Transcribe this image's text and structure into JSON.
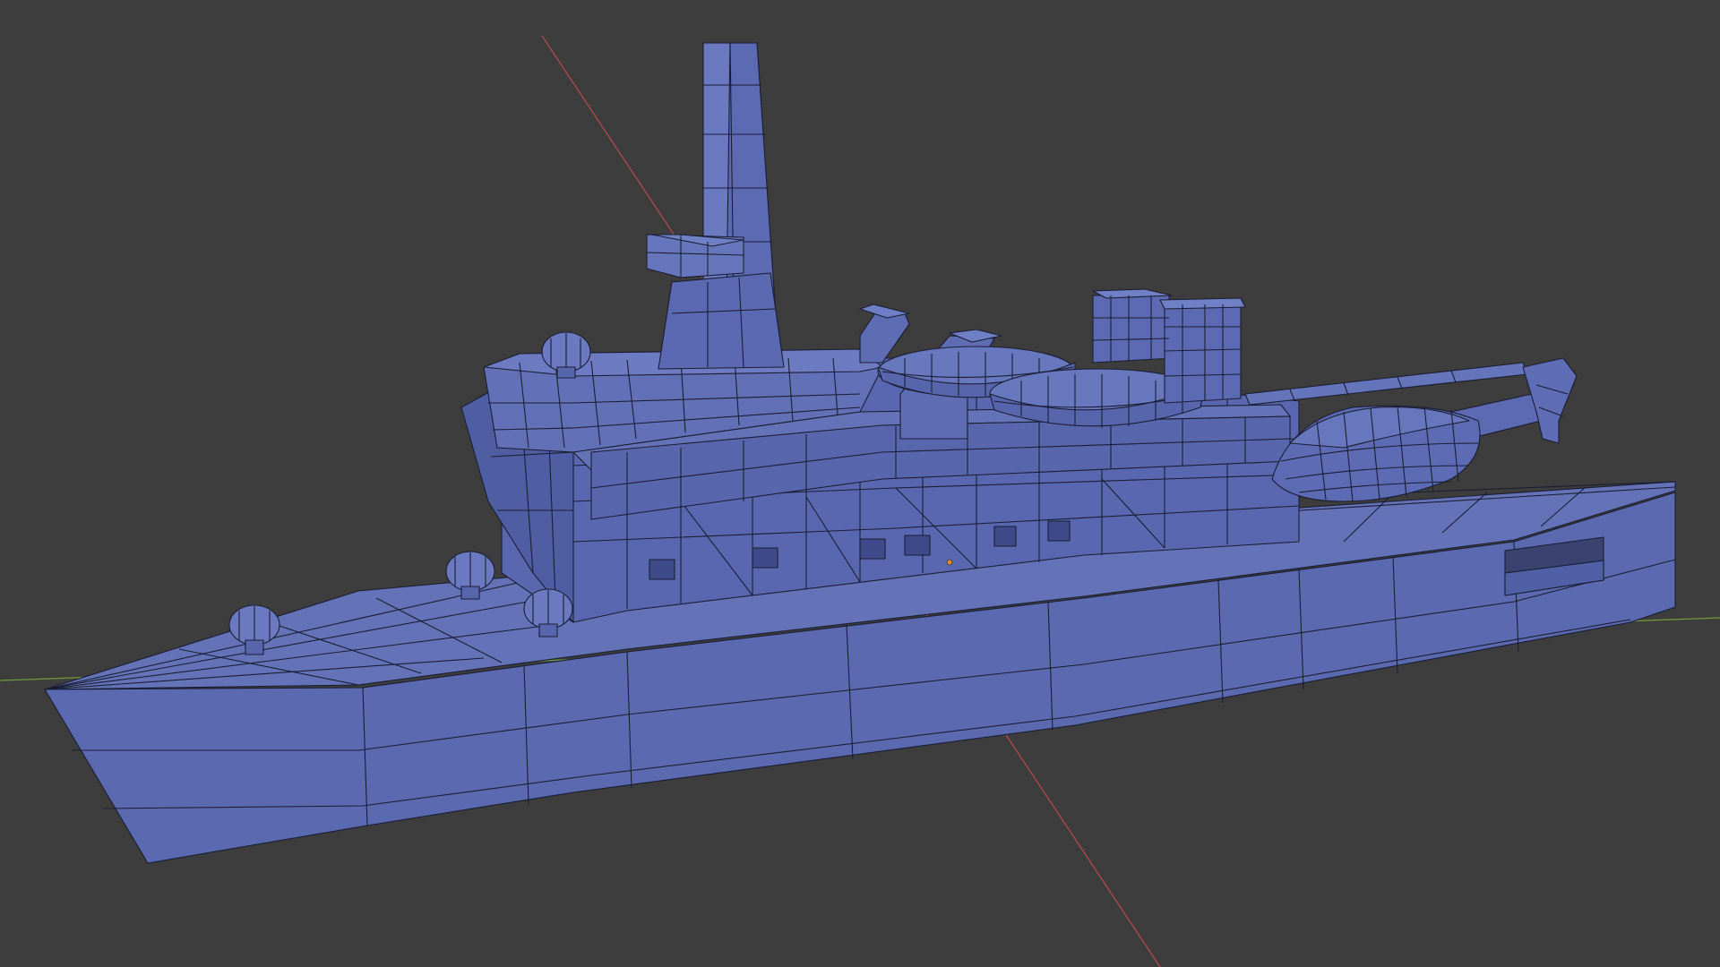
{
  "viewport": {
    "background": "#3d3d3d",
    "grid_color": "#444444",
    "axis_x_color": "#b24a4a",
    "axis_y_color": "#6f9a3a"
  },
  "model": {
    "face_color": "#5b69b0",
    "face_shade_color": "#4d5a9e",
    "face_light_color": "#6876bd",
    "wire_color": "#1b1e33",
    "origin_color": "#e08a2a"
  }
}
